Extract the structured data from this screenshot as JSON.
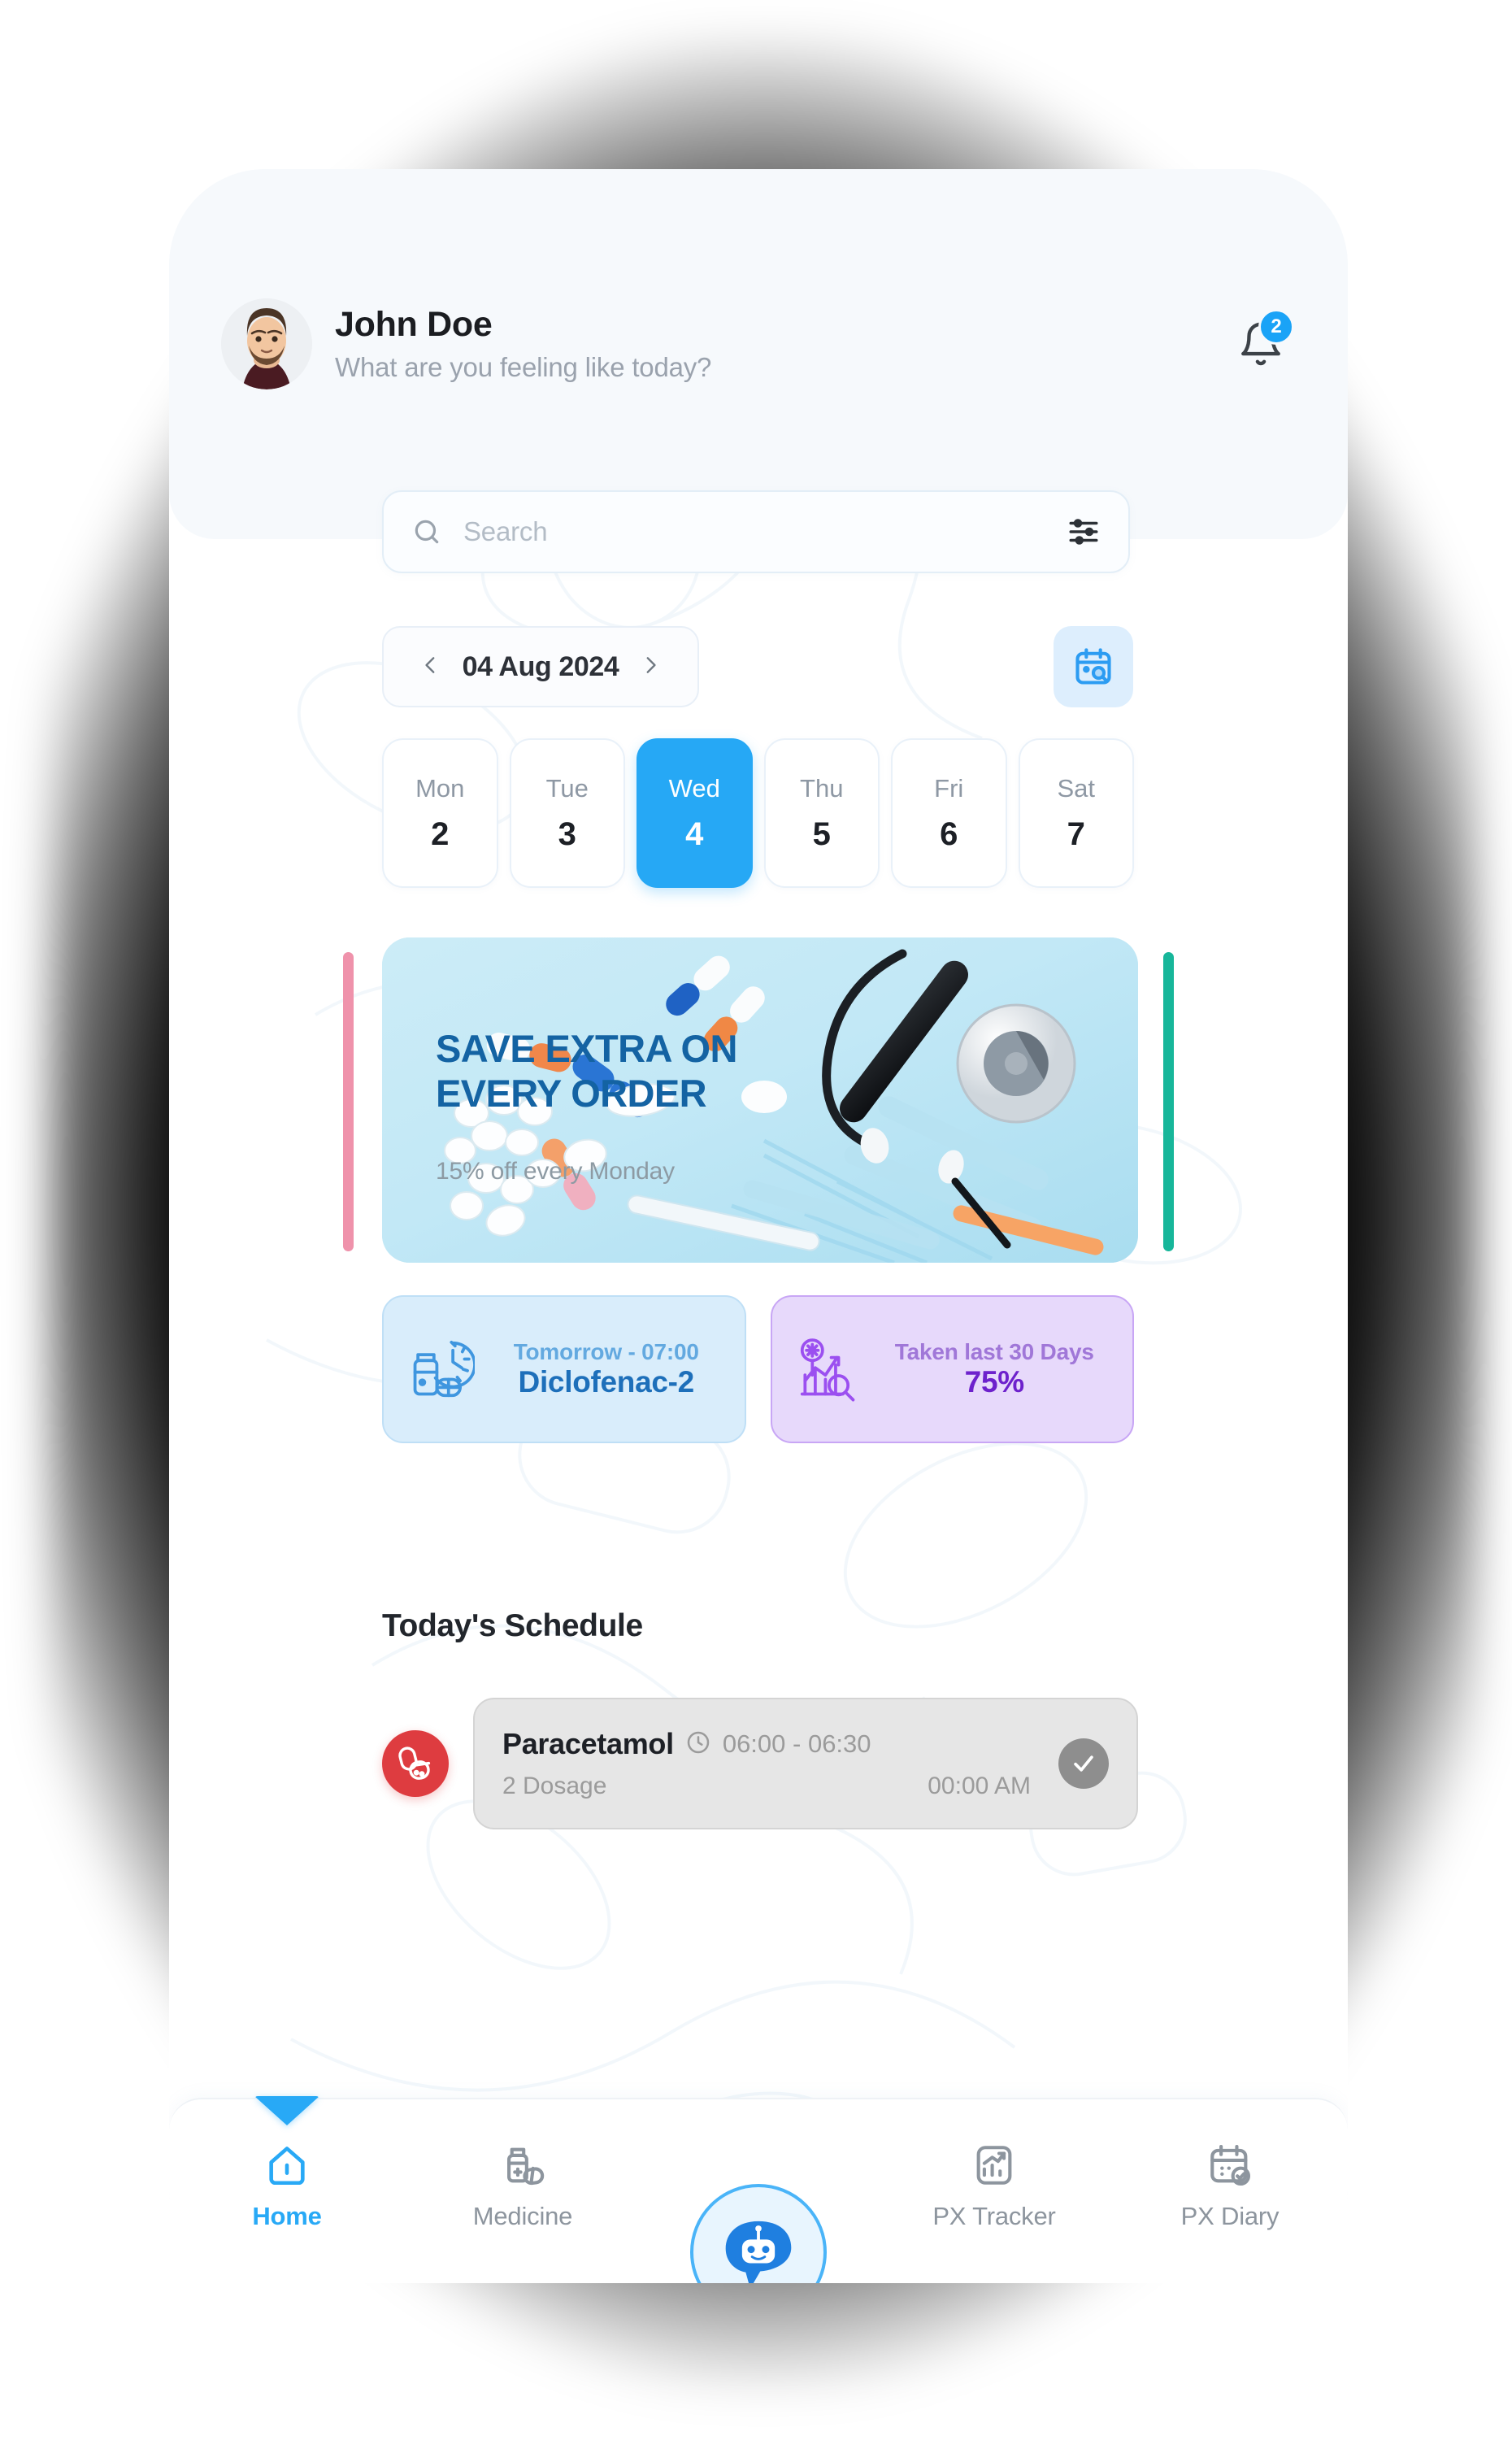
{
  "header": {
    "profile_name": "John Doe",
    "greeting": "What are you feeling like today?",
    "avatar_icon": "user-avatar-photo",
    "bell_icon": "notification-bell-icon",
    "notification_count": "2"
  },
  "search": {
    "placeholder": "Search",
    "value": "",
    "search_icon": "search-icon",
    "filter_icon": "filter-sliders-icon"
  },
  "date_nav": {
    "prev_icon": "chevron-left-icon",
    "label": "04 Aug 2024",
    "next_icon": "chevron-right-icon",
    "calendar_button_icon": "calendar-search-icon"
  },
  "days": [
    {
      "dow": "Mon",
      "num": "2",
      "active": false
    },
    {
      "dow": "Tue",
      "num": "3",
      "active": false
    },
    {
      "dow": "Wed",
      "num": "4",
      "active": true
    },
    {
      "dow": "Thu",
      "num": "5",
      "active": false
    },
    {
      "dow": "Fri",
      "num": "6",
      "active": false
    },
    {
      "dow": "Sat",
      "num": "7",
      "active": false
    }
  ],
  "promo": {
    "title": "SAVE EXTRA ON EVERY ORDER",
    "subtitle": "15% off every Monday",
    "image_alt": "pills-stethoscope-syringes-photo",
    "peek_left_color": "#ef92ab",
    "peek_right_color": "#17b69a",
    "background_color": "#cbeaf5",
    "title_color": "#1463a3"
  },
  "stats": [
    {
      "icon": "pill-bottle-clock-icon",
      "top": "Tomorrow - 07:00",
      "bottom": "Diclofenac-2",
      "accent": "#1d6fba"
    },
    {
      "icon": "bar-chart-magnifier-icon",
      "top": "Taken last 30 Days",
      "bottom": "75%",
      "accent": "#6d21cc"
    }
  ],
  "schedule": {
    "title": "Today's Schedule",
    "items": [
      {
        "pill_icon": "capsule-pill-icon",
        "name": "Paracetamol",
        "clock_icon": "clock-icon",
        "range": "06:00 - 06:30",
        "dosage": "2 Dosage",
        "time": "00:00 AM",
        "check_icon": "check-circle-icon",
        "taken": true
      }
    ]
  },
  "bottom_nav": {
    "items": [
      {
        "label": "Home",
        "icon": "home-icon",
        "active": true
      },
      {
        "label": "Medicine",
        "icon": "medicine-bottle-icon",
        "active": false
      },
      {
        "label": "PX Tracker",
        "icon": "tracker-chart-icon",
        "active": false
      },
      {
        "label": "PX Diary",
        "icon": "calendar-check-icon",
        "active": false
      }
    ],
    "fab": {
      "icon": "chatbot-robot-icon",
      "color": "#1f7fe0"
    }
  },
  "theme": {
    "accent": "#26a8f5",
    "header_bg": "#f6f9fc"
  }
}
